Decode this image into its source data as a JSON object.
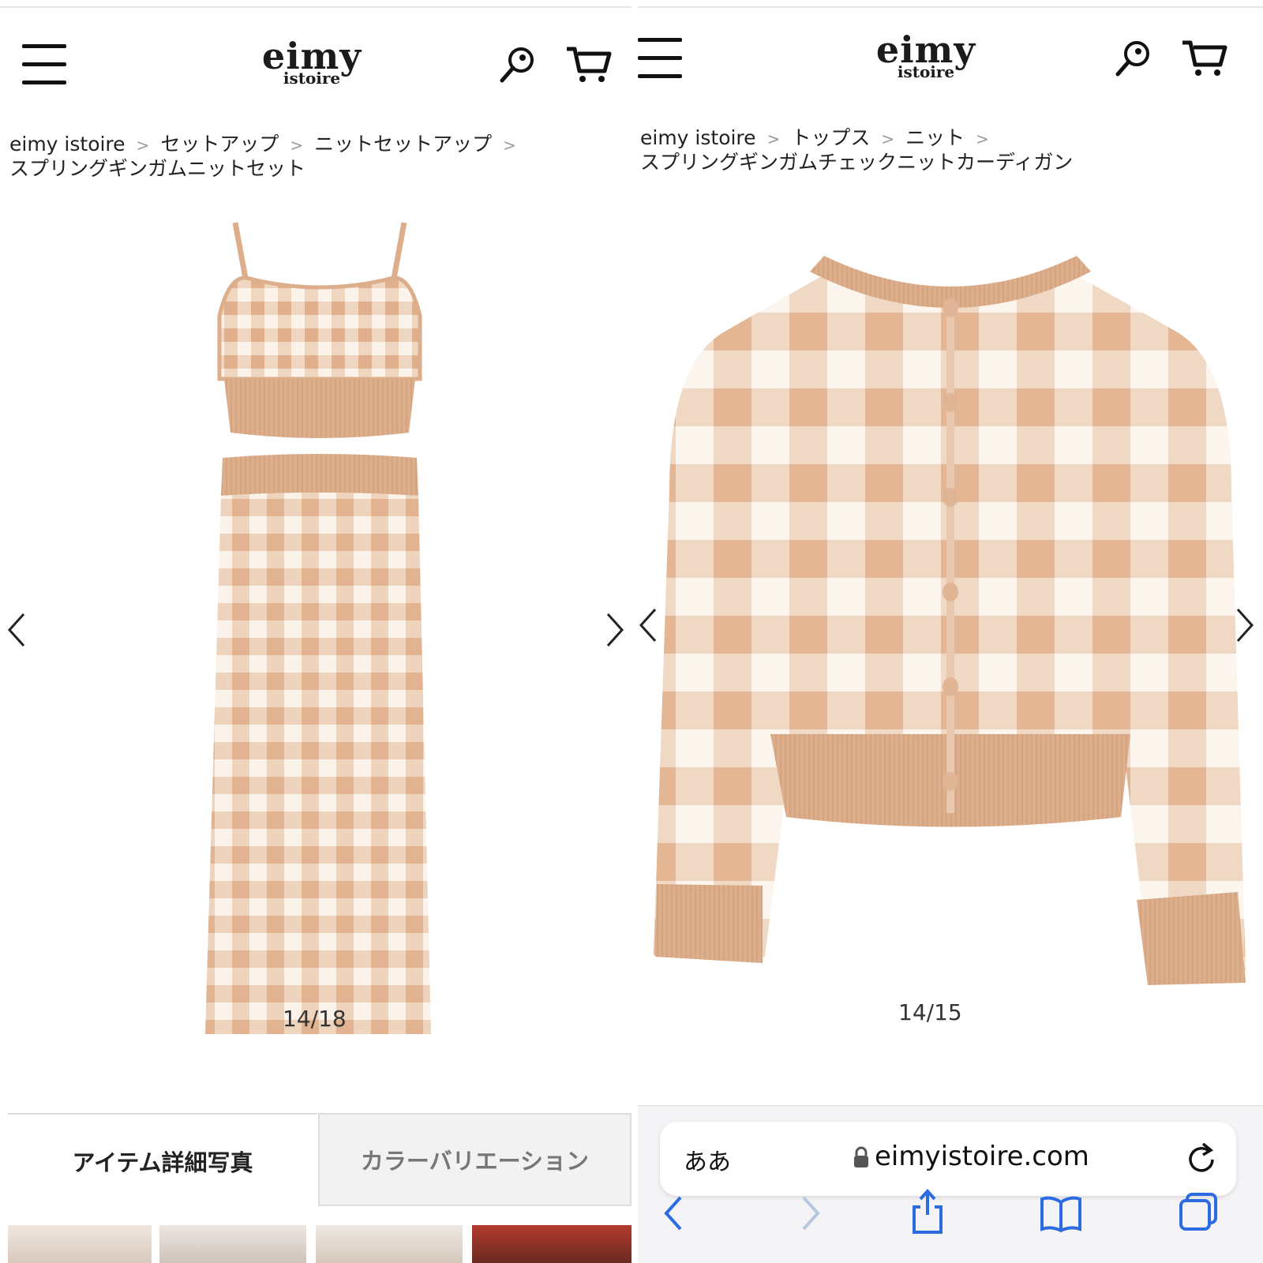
{
  "left": {
    "logo": {
      "main": "eimy",
      "sub": "istoire"
    },
    "breadcrumb": {
      "items": [
        "eimy istoire",
        "セットアップ",
        "ニットセットアップ"
      ],
      "current": "スプリングギンガムニットセット",
      "separator": ">"
    },
    "slide_counter": "14/18",
    "tabs": {
      "active": "アイテム詳細写真",
      "inactive": "カラーバリエーション"
    }
  },
  "right": {
    "logo": {
      "main": "eimy",
      "sub": "istoire"
    },
    "breadcrumb": {
      "items": [
        "eimy istoire",
        "トップス",
        "ニット"
      ],
      "current": "スプリングギンガムチェックニットカーディガン",
      "separator": ">"
    },
    "slide_counter": "14/15",
    "safari": {
      "text_size_label": "ああ",
      "url": "eimyistoire.com"
    }
  },
  "colors": {
    "gingham_dark": "#e2b594",
    "gingham_light": "#fbf3ea",
    "gingham_mid": "#eed2bb",
    "rib": "#dcae8c"
  }
}
